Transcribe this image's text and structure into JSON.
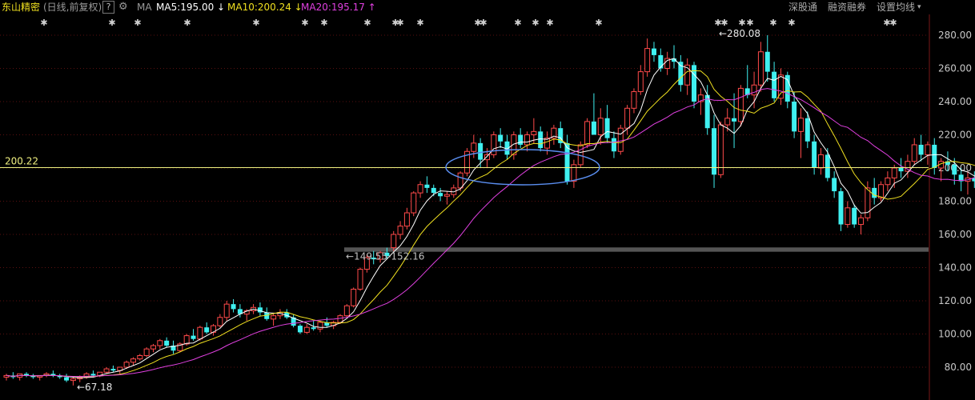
{
  "header": {
    "title": "东山精密",
    "subtitle": "(日线,前复权)",
    "help": "?",
    "ma_label": "MA",
    "ma5": "MA5:195.00 ↓",
    "ma10": "MA10:200.24 ↓",
    "ma20": "MA20:195.17 ↑",
    "tools": [
      "深股通",
      "融资融券",
      "设置均线"
    ],
    "dropdown": "▾"
  },
  "colors": {
    "up": "#ff4a4a",
    "down": "#3ff0f0",
    "ma5": "#ffffff",
    "ma10": "#f0e020",
    "ma20": "#e040e0",
    "hline": "#f0f080",
    "ellipse": "#5a8ef0",
    "grid": "#5a1010"
  },
  "chart_data": {
    "type": "candlestick",
    "ylim": [
      70,
      290
    ],
    "yticks": [
      "280.00",
      "260.00",
      "240.00",
      "220.00",
      "200.00",
      "180.00",
      "160.00",
      "140.00",
      "120.00",
      "100.00",
      "80.00"
    ],
    "ytick_values": [
      280,
      260,
      240,
      220,
      200,
      180,
      160,
      140,
      120,
      100,
      80
    ],
    "hline": {
      "value": 200.22,
      "label": "200.22"
    },
    "max_label": {
      "value": 280.08,
      "label": "280.08"
    },
    "min_label": {
      "value": 67.18,
      "label": "67.18"
    },
    "gap_zone": {
      "low": 149.55,
      "high": 152.16,
      "label": "149.55-152.16"
    },
    "ohlc": [
      [
        74,
        76,
        72,
        75
      ],
      [
        75,
        77,
        73,
        74
      ],
      [
        74,
        76,
        72,
        76
      ],
      [
        76,
        77,
        74,
        75
      ],
      [
        75,
        76,
        73,
        74
      ],
      [
        74,
        75,
        72,
        75
      ],
      [
        75,
        77,
        74,
        76
      ],
      [
        76,
        78,
        74,
        75
      ],
      [
        75,
        76,
        73,
        74
      ],
      [
        74,
        76,
        71,
        72
      ],
      [
        72,
        74,
        69,
        73
      ],
      [
        73,
        75,
        71,
        74
      ],
      [
        74,
        77,
        73,
        76
      ],
      [
        76,
        78,
        74,
        75
      ],
      [
        75,
        77,
        74,
        77
      ],
      [
        77,
        80,
        76,
        79
      ],
      [
        79,
        81,
        77,
        78
      ],
      [
        78,
        80,
        76,
        80
      ],
      [
        80,
        84,
        79,
        83
      ],
      [
        83,
        86,
        81,
        85
      ],
      [
        85,
        88,
        84,
        87
      ],
      [
        87,
        92,
        86,
        91
      ],
      [
        91,
        94,
        89,
        93
      ],
      [
        93,
        97,
        91,
        96
      ],
      [
        96,
        98,
        92,
        93
      ],
      [
        93,
        96,
        88,
        90
      ],
      [
        90,
        95,
        89,
        94
      ],
      [
        94,
        100,
        93,
        99
      ],
      [
        99,
        103,
        96,
        97
      ],
      [
        97,
        105,
        96,
        104
      ],
      [
        104,
        107,
        100,
        101
      ],
      [
        101,
        106,
        99,
        105
      ],
      [
        105,
        112,
        104,
        110
      ],
      [
        110,
        120,
        108,
        118
      ],
      [
        118,
        121,
        113,
        115
      ],
      [
        115,
        118,
        110,
        112
      ],
      [
        112,
        115,
        108,
        114
      ],
      [
        114,
        118,
        112,
        116
      ],
      [
        116,
        119,
        111,
        113
      ],
      [
        113,
        116,
        108,
        109
      ],
      [
        109,
        112,
        105,
        111
      ],
      [
        111,
        115,
        109,
        113
      ],
      [
        113,
        115,
        109,
        110
      ],
      [
        110,
        112,
        104,
        105
      ],
      [
        105,
        106,
        100,
        101
      ],
      [
        101,
        106,
        100,
        104
      ],
      [
        104,
        108,
        102,
        103
      ],
      [
        103,
        108,
        101,
        107
      ],
      [
        107,
        110,
        104,
        105
      ],
      [
        105,
        108,
        103,
        107
      ],
      [
        107,
        112,
        106,
        111
      ],
      [
        111,
        118,
        110,
        117
      ],
      [
        117,
        128,
        116,
        127
      ],
      [
        127,
        140,
        126,
        139
      ],
      [
        139,
        148,
        137,
        146
      ],
      [
        146,
        150,
        142,
        145
      ],
      [
        145,
        150,
        143,
        149
      ],
      [
        149,
        152,
        145,
        147
      ],
      [
        152,
        162,
        150,
        160
      ],
      [
        160,
        168,
        157,
        165
      ],
      [
        165,
        176,
        163,
        173
      ],
      [
        173,
        186,
        171,
        185
      ],
      [
        185,
        192,
        182,
        190
      ],
      [
        190,
        195,
        185,
        188
      ],
      [
        188,
        190,
        183,
        185
      ],
      [
        185,
        188,
        180,
        183
      ],
      [
        183,
        186,
        178,
        184
      ],
      [
        184,
        190,
        182,
        188
      ],
      [
        188,
        198,
        186,
        197
      ],
      [
        197,
        212,
        195,
        210
      ],
      [
        210,
        220,
        206,
        215
      ],
      [
        215,
        218,
        200,
        205
      ],
      [
        205,
        212,
        200,
        208
      ],
      [
        208,
        222,
        206,
        220
      ],
      [
        220,
        224,
        212,
        216
      ],
      [
        216,
        220,
        205,
        208
      ],
      [
        208,
        222,
        205,
        220
      ],
      [
        220,
        224,
        212,
        214
      ],
      [
        214,
        222,
        210,
        220
      ],
      [
        220,
        230,
        215,
        222
      ],
      [
        222,
        225,
        210,
        212
      ],
      [
        212,
        222,
        208,
        218
      ],
      [
        218,
        226,
        214,
        224
      ],
      [
        224,
        228,
        212,
        215
      ],
      [
        215,
        220,
        190,
        192
      ],
      [
        192,
        205,
        188,
        202
      ],
      [
        202,
        216,
        200,
        214
      ],
      [
        214,
        230,
        212,
        228
      ],
      [
        228,
        245,
        226,
        220
      ],
      [
        220,
        236,
        214,
        230
      ],
      [
        230,
        238,
        215,
        218
      ],
      [
        218,
        222,
        206,
        210
      ],
      [
        210,
        226,
        208,
        224
      ],
      [
        224,
        238,
        220,
        236
      ],
      [
        236,
        248,
        233,
        246
      ],
      [
        246,
        262,
        244,
        258
      ],
      [
        258,
        278,
        255,
        272
      ],
      [
        272,
        276,
        264,
        268
      ],
      [
        268,
        272,
        258,
        260
      ],
      [
        260,
        270,
        256,
        266
      ],
      [
        266,
        274,
        260,
        264
      ],
      [
        264,
        268,
        246,
        250
      ],
      [
        250,
        266,
        244,
        262
      ],
      [
        262,
        264,
        236,
        240
      ],
      [
        240,
        248,
        232,
        244
      ],
      [
        244,
        250,
        220,
        224
      ],
      [
        224,
        232,
        188,
        196
      ],
      [
        196,
        228,
        194,
        226
      ],
      [
        226,
        236,
        222,
        230
      ],
      [
        230,
        245,
        212,
        228
      ],
      [
        228,
        250,
        225,
        248
      ],
      [
        248,
        262,
        242,
        244
      ],
      [
        244,
        258,
        236,
        250
      ],
      [
        250,
        276,
        246,
        270
      ],
      [
        270,
        280,
        252,
        258
      ],
      [
        258,
        264,
        240,
        242
      ],
      [
        242,
        260,
        238,
        256
      ],
      [
        256,
        258,
        236,
        240
      ],
      [
        240,
        246,
        218,
        222
      ],
      [
        222,
        236,
        206,
        230
      ],
      [
        230,
        234,
        212,
        216
      ],
      [
        216,
        220,
        196,
        200
      ],
      [
        200,
        212,
        196,
        208
      ],
      [
        208,
        212,
        192,
        194
      ],
      [
        194,
        198,
        182,
        186
      ],
      [
        186,
        188,
        162,
        166
      ],
      [
        166,
        180,
        164,
        176
      ],
      [
        176,
        178,
        164,
        166
      ],
      [
        166,
        172,
        160,
        170
      ],
      [
        170,
        192,
        168,
        188
      ],
      [
        188,
        194,
        178,
        182
      ],
      [
        182,
        192,
        180,
        190
      ],
      [
        190,
        198,
        186,
        194
      ],
      [
        194,
        202,
        188,
        200
      ],
      [
        200,
        206,
        194,
        198
      ],
      [
        198,
        208,
        194,
        204
      ],
      [
        204,
        218,
        202,
        214
      ],
      [
        214,
        220,
        204,
        208
      ],
      [
        208,
        216,
        202,
        214
      ],
      [
        214,
        218,
        196,
        200
      ],
      [
        200,
        206,
        192,
        204
      ],
      [
        204,
        210,
        198,
        202
      ],
      [
        202,
        206,
        190,
        196
      ],
      [
        196,
        200,
        186,
        192
      ],
      [
        192,
        198,
        184,
        194
      ],
      [
        194,
        198,
        188,
        192
      ],
      [
        192,
        206,
        190,
        203
      ]
    ],
    "markers": [
      55,
      140,
      172,
      234,
      320,
      381,
      405,
      459,
      494,
      500,
      525,
      597,
      604,
      647,
      669,
      687,
      748,
      897,
      905,
      927,
      937,
      966,
      989,
      1108,
      1116
    ]
  }
}
